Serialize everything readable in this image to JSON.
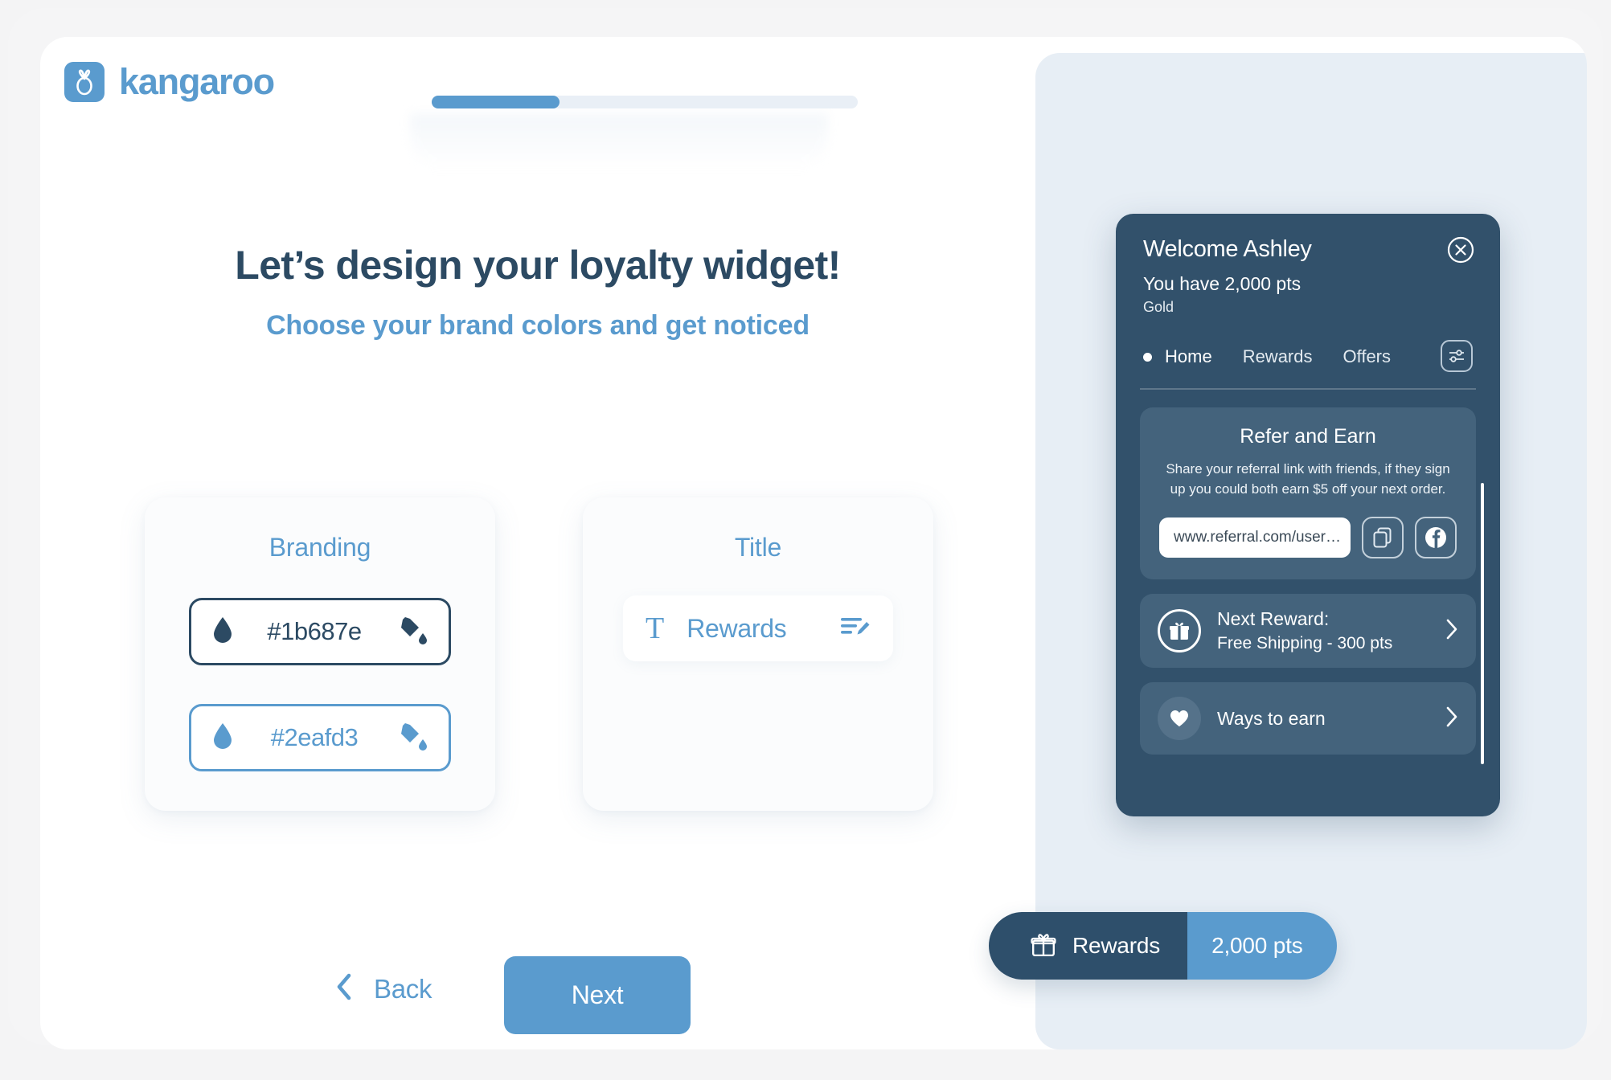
{
  "brand": {
    "name": "kangaroo",
    "logo_icon": "kangaroo-logo-icon",
    "accent": "#5a9bce",
    "dark": "#2c4a63"
  },
  "progress": {
    "percent": 30,
    "label": "Step progress"
  },
  "heading": "Let’s design your loyalty widget!",
  "subheading": "Choose your brand colors and get noticed",
  "branding_card": {
    "label": "Branding",
    "colors": [
      {
        "value": "#1b687e",
        "swatch": "#2c4a63",
        "drop_icon": "water-drop-icon",
        "fill_icon": "paint-bucket-icon",
        "selected": true
      },
      {
        "value": "#2eafd3",
        "swatch": "#5a9bce",
        "drop_icon": "water-drop-icon",
        "fill_icon": "paint-bucket-icon",
        "selected": false
      }
    ]
  },
  "title_card": {
    "label": "Title",
    "text_icon": "T",
    "value": "Rewards",
    "edit_icon": "edit-text-icon"
  },
  "footer": {
    "back_label": "Back",
    "back_icon": "chevron-left-icon",
    "next_label": "Next"
  },
  "widget": {
    "welcome": "Welcome Ashley",
    "points": "You have 2,000 pts",
    "tier": "Gold",
    "close_icon": "close-circle-icon",
    "settings_icon": "sliders-icon",
    "nav": [
      {
        "label": "Home",
        "active": true
      },
      {
        "label": "Rewards",
        "active": false
      },
      {
        "label": "Offers",
        "active": false
      }
    ],
    "refer": {
      "title": "Refer and Earn",
      "description": "Share your referral link with friends, if they sign up you could both earn $5 off your next order.",
      "link": "www.referral.com/user…",
      "copy_icon": "copy-icon",
      "facebook_icon": "facebook-icon"
    },
    "rows": [
      {
        "title": "Next Reward:",
        "subtitle": "Free Shipping - 300 pts",
        "icon": "gift-ring-icon",
        "chevron": "chevron-right-icon"
      },
      {
        "title": "Ways to earn",
        "subtitle": "",
        "icon": "heart-icon",
        "chevron": "chevron-right-icon"
      }
    ]
  },
  "reward_pill": {
    "icon": "gift-icon",
    "label": "Rewards",
    "points": "2,000 pts"
  }
}
